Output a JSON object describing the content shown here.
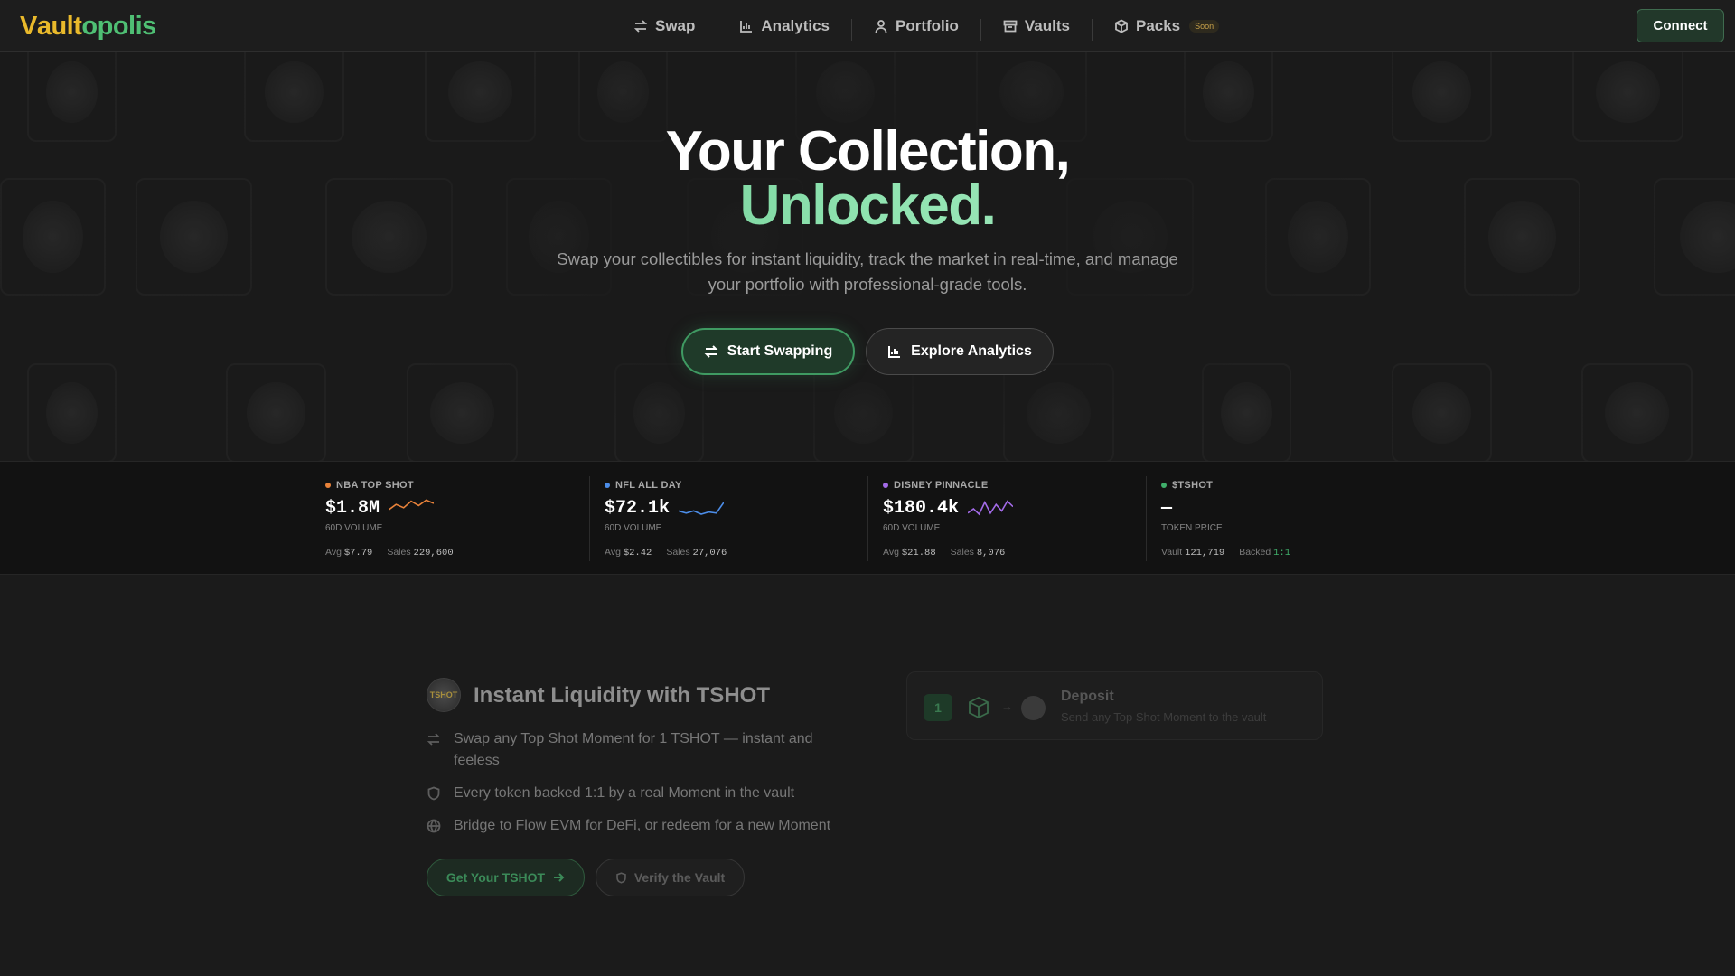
{
  "nav": {
    "logo": {
      "v": "V",
      "ault": "ault",
      "opolis": "opolis"
    },
    "links": [
      {
        "label": "Swap",
        "icon": "swap-icon"
      },
      {
        "label": "Analytics",
        "icon": "bar-chart-icon"
      },
      {
        "label": "Portfolio",
        "icon": "user-icon"
      },
      {
        "label": "Vaults",
        "icon": "archive-icon"
      },
      {
        "label": "Packs",
        "icon": "package-icon",
        "badge": "Soon"
      }
    ],
    "connect_label": "Connect"
  },
  "hero": {
    "title_line1": "Your Collection,",
    "title_line2": "Unlocked.",
    "subtitle_line1": "Swap your collectibles for instant liquidity, track the market in real-time, and manage",
    "subtitle_line2": "your portfolio with professional-grade tools.",
    "primary_button": "Start Swapping",
    "secondary_button": "Explore Analytics"
  },
  "stats": [
    {
      "name": "NBA TOP SHOT",
      "dot_color": "#e8823a",
      "value": "$1.8M",
      "label": "60D VOLUME",
      "avg_label": "Avg",
      "avg": "$7.79",
      "sales_label": "Sales",
      "sales": "229,600",
      "spark_color": "#e8823a",
      "spark": [
        0.55,
        0.3,
        0.45,
        0.15,
        0.35,
        0.1,
        0.25
      ]
    },
    {
      "name": "NFL ALL DAY",
      "dot_color": "#4c8de8",
      "value": "$72.1k",
      "label": "60D VOLUME",
      "avg_label": "Avg",
      "avg": "$2.42",
      "sales_label": "Sales",
      "sales": "27,076",
      "spark_color": "#4c8de8",
      "spark": [
        0.6,
        0.7,
        0.6,
        0.75,
        0.65,
        0.7,
        0.2
      ]
    },
    {
      "name": "DISNEY PINNACLE",
      "dot_color": "#a36be8",
      "value": "$180.4k",
      "label": "60D VOLUME",
      "avg_label": "Avg",
      "avg": "$21.88",
      "sales_label": "Sales",
      "sales": "8,076",
      "spark_color": "#a36be8",
      "spark": [
        0.7,
        0.5,
        0.75,
        0.2,
        0.7,
        0.3,
        0.6,
        0.15,
        0.4
      ]
    },
    {
      "name": "$TSHOT",
      "dot_color": "#3fae6a",
      "value": "—",
      "label": "TOKEN PRICE",
      "avg_label": "Vault",
      "avg": "121,719",
      "sales_label": "Backed",
      "sales": "1:1"
    }
  ],
  "feature": {
    "token_text": "TSHOT",
    "title": "Instant Liquidity with TSHOT",
    "items": [
      {
        "icon": "swap-icon",
        "text": "Swap any Top Shot Moment for 1 TSHOT — instant and feeless"
      },
      {
        "icon": "shield-icon",
        "text": "Every token backed 1:1 by a real Moment in the vault"
      },
      {
        "icon": "globe-icon",
        "text": "Bridge to Flow EVM for DeFi, or redeem for a new Moment"
      }
    ],
    "cta_primary": "Get Your TSHOT",
    "cta_secondary": "Verify the Vault",
    "step": {
      "number": "1",
      "arrow": "→",
      "title": "Deposit",
      "desc": "Send any Top Shot Moment to the vault"
    }
  }
}
